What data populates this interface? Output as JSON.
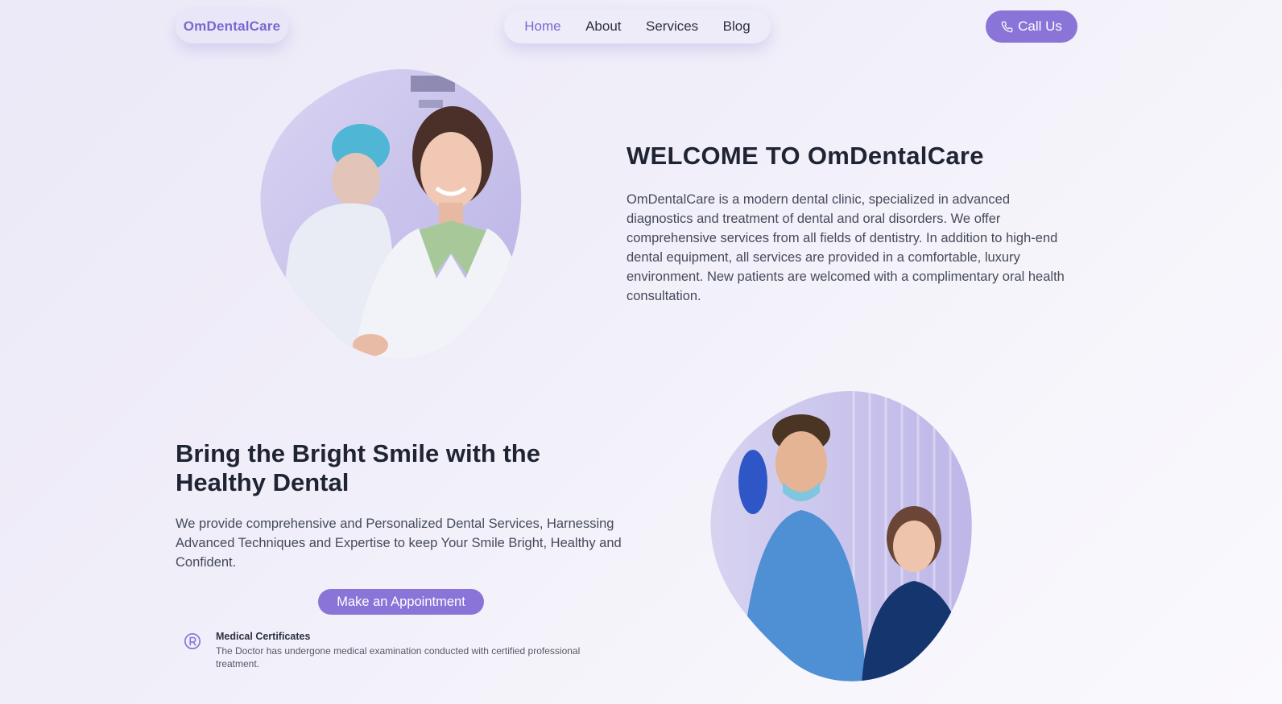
{
  "nav": {
    "logo": "OmDentalCare",
    "links": [
      "Home",
      "About",
      "Services",
      "Blog"
    ],
    "active": "Home",
    "cta_label": "Call Us"
  },
  "welcome": {
    "title": "WELCOME TO OmDentalCare",
    "body": "OmDentalCare is a modern dental clinic, specialized in advanced diagnostics and treatment of dental and oral disorders. We offer comprehensive services from all fields of dentistry. In addition to high-end dental equipment, all services are provided in a comfortable, luxury environment. New patients are welcomed with a complimentary oral health consultation."
  },
  "smile": {
    "title": "Bring the Bright Smile with the Healthy Dental",
    "body": "We provide comprehensive and Personalized Dental Services, Harnessing Advanced Techniques and Expertise to keep Your Smile Bright, Healthy and Confident.",
    "cta_label": "Make an Appointment"
  },
  "certificate": {
    "icon": "registered-icon",
    "title": "Medical Certificates",
    "body": "The Doctor has undergone medical examination conducted with certified professional treatment."
  },
  "colors": {
    "accent": "#8a74d8",
    "heading": "#1f2433",
    "body_text": "#454a5a",
    "background": "#f1eff9"
  }
}
